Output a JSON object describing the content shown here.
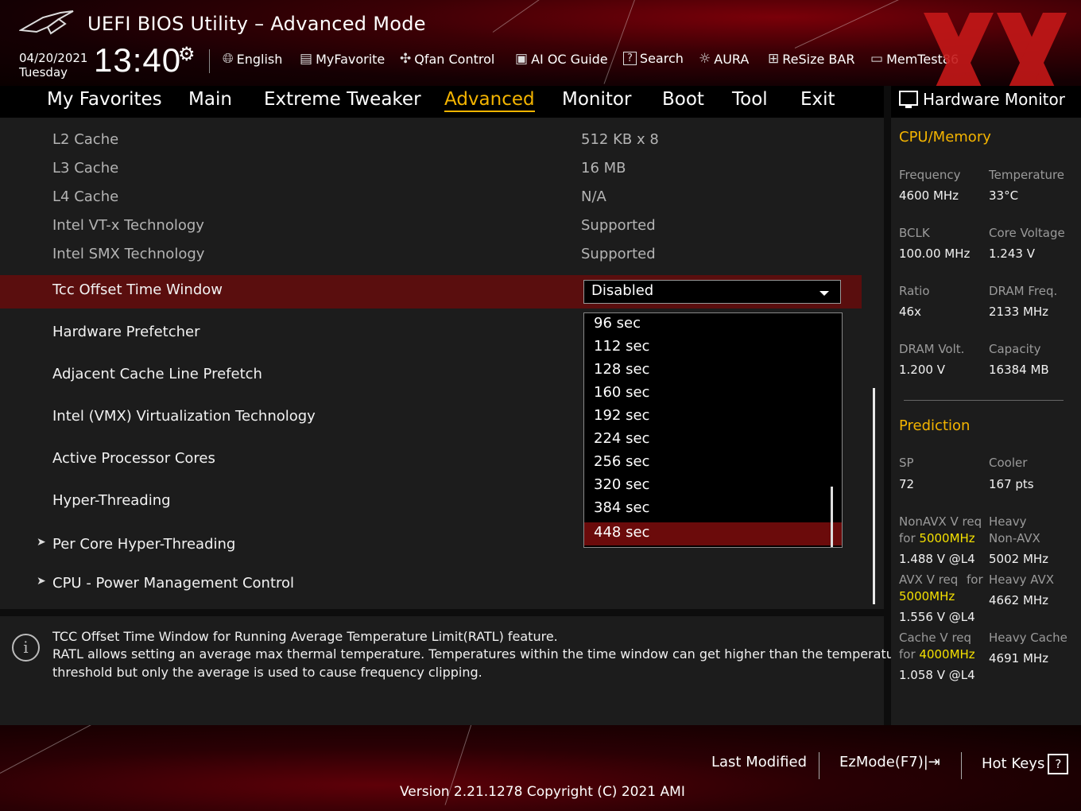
{
  "header": {
    "title": "UEFI BIOS Utility – Advanced Mode",
    "date": "04/20/2021",
    "day": "Tuesday",
    "time": "13:40",
    "tools": [
      {
        "label": "English",
        "icon": "globe-icon"
      },
      {
        "label": "MyFavorite",
        "icon": "favorite-icon"
      },
      {
        "label": "Qfan Control",
        "icon": "fan-icon"
      },
      {
        "label": "AI OC Guide",
        "icon": "chip-icon"
      },
      {
        "label": "Search",
        "icon": "search-help-icon"
      },
      {
        "label": "AURA",
        "icon": "aura-light-icon"
      },
      {
        "label": "ReSize BAR",
        "icon": "resize-bar-icon"
      },
      {
        "label": "MemTest86",
        "icon": "memory-icon"
      }
    ]
  },
  "nav": {
    "tabs": [
      "My Favorites",
      "Main",
      "Extreme Tweaker",
      "Advanced",
      "Monitor",
      "Boot",
      "Tool",
      "Exit"
    ],
    "active": "Advanced"
  },
  "settings": {
    "info_rows": [
      {
        "label": "L2 Cache",
        "value": "512 KB x 8"
      },
      {
        "label": "L3 Cache",
        "value": "16 MB"
      },
      {
        "label": "L4 Cache",
        "value": "N/A"
      },
      {
        "label": "Intel VT-x Technology",
        "value": "Supported"
      },
      {
        "label": "Intel SMX Technology",
        "value": "Supported"
      }
    ],
    "selected": {
      "label": "Tcc Offset Time Window",
      "value": "Disabled"
    },
    "option_rows": [
      "Hardware Prefetcher",
      "Adjacent Cache Line Prefetch",
      "Intel (VMX) Virtualization Technology",
      "Active Processor Cores",
      "Hyper-Threading"
    ],
    "submenus": [
      "Per Core Hyper-Threading",
      "CPU - Power Management Control"
    ],
    "dropdown_options": [
      "96 sec",
      "112 sec",
      "128 sec",
      "160 sec",
      "192 sec",
      "224 sec",
      "256 sec",
      "320 sec",
      "384 sec",
      "448 sec"
    ],
    "dropdown_highlighted": "448 sec"
  },
  "help": {
    "line1": "TCC Offset Time Window for Running Average Temperature Limit(RATL) feature.",
    "line2": "RATL allows setting an average max thermal temperature. Temperatures within the time window can get higher than the temperature",
    "line3": "threshold but only the average is used to cause frequency clipping."
  },
  "hw_monitor": {
    "title": "Hardware Monitor",
    "cpu_memory": {
      "heading": "CPU/Memory",
      "items": [
        {
          "label": "Frequency",
          "value": "4600 MHz"
        },
        {
          "label": "Temperature",
          "value": "33°C"
        },
        {
          "label": "BCLK",
          "value": "100.00 MHz"
        },
        {
          "label": "Core Voltage",
          "value": "1.243 V"
        },
        {
          "label": "Ratio",
          "value": "46x"
        },
        {
          "label": "DRAM Freq.",
          "value": "2133 MHz"
        },
        {
          "label": "DRAM Volt.",
          "value": "1.200 V"
        },
        {
          "label": "Capacity",
          "value": "16384 MB"
        }
      ]
    },
    "prediction": {
      "heading": "Prediction",
      "sp_label": "SP",
      "sp_value": "72",
      "cooler_label": "Cooler",
      "cooler_value": "167 pts",
      "nonavx_label": "NonAVX V req",
      "nonavx_for": "for",
      "nonavx_freq": "5000MHz",
      "nonavx_value": "1.488 V @L4",
      "heavy_nonavx_label1": "Heavy",
      "heavy_nonavx_label2": "Non-AVX",
      "heavy_nonavx_value": "5002 MHz",
      "avx_label": "AVX V req",
      "avx_for": "for",
      "avx_freq": "5000MHz",
      "avx_value": "1.556 V @L4",
      "heavy_avx_label": "Heavy AVX",
      "heavy_avx_value": "4662 MHz",
      "cache_label": "Cache V req",
      "cache_for": "for",
      "cache_freq": "4000MHz",
      "cache_value": "1.058 V @L4",
      "heavy_cache_label": "Heavy Cache",
      "heavy_cache_value": "4691 MHz"
    }
  },
  "footer": {
    "last_modified": "Last Modified",
    "ezmode": "EzMode(F7)|",
    "hotkeys": "Hot Keys",
    "hotkeys_icon_glyph": "?",
    "version": "Version 2.21.1278 Copyright (C) 2021 AMI"
  },
  "colors": {
    "accent": "#f4b400",
    "highlight_row": "#5a0e0e",
    "dropdown_selected": "#6b0b0b",
    "voltage_highlight": "#f4e000",
    "panel_bg": "#1c1c1c"
  }
}
